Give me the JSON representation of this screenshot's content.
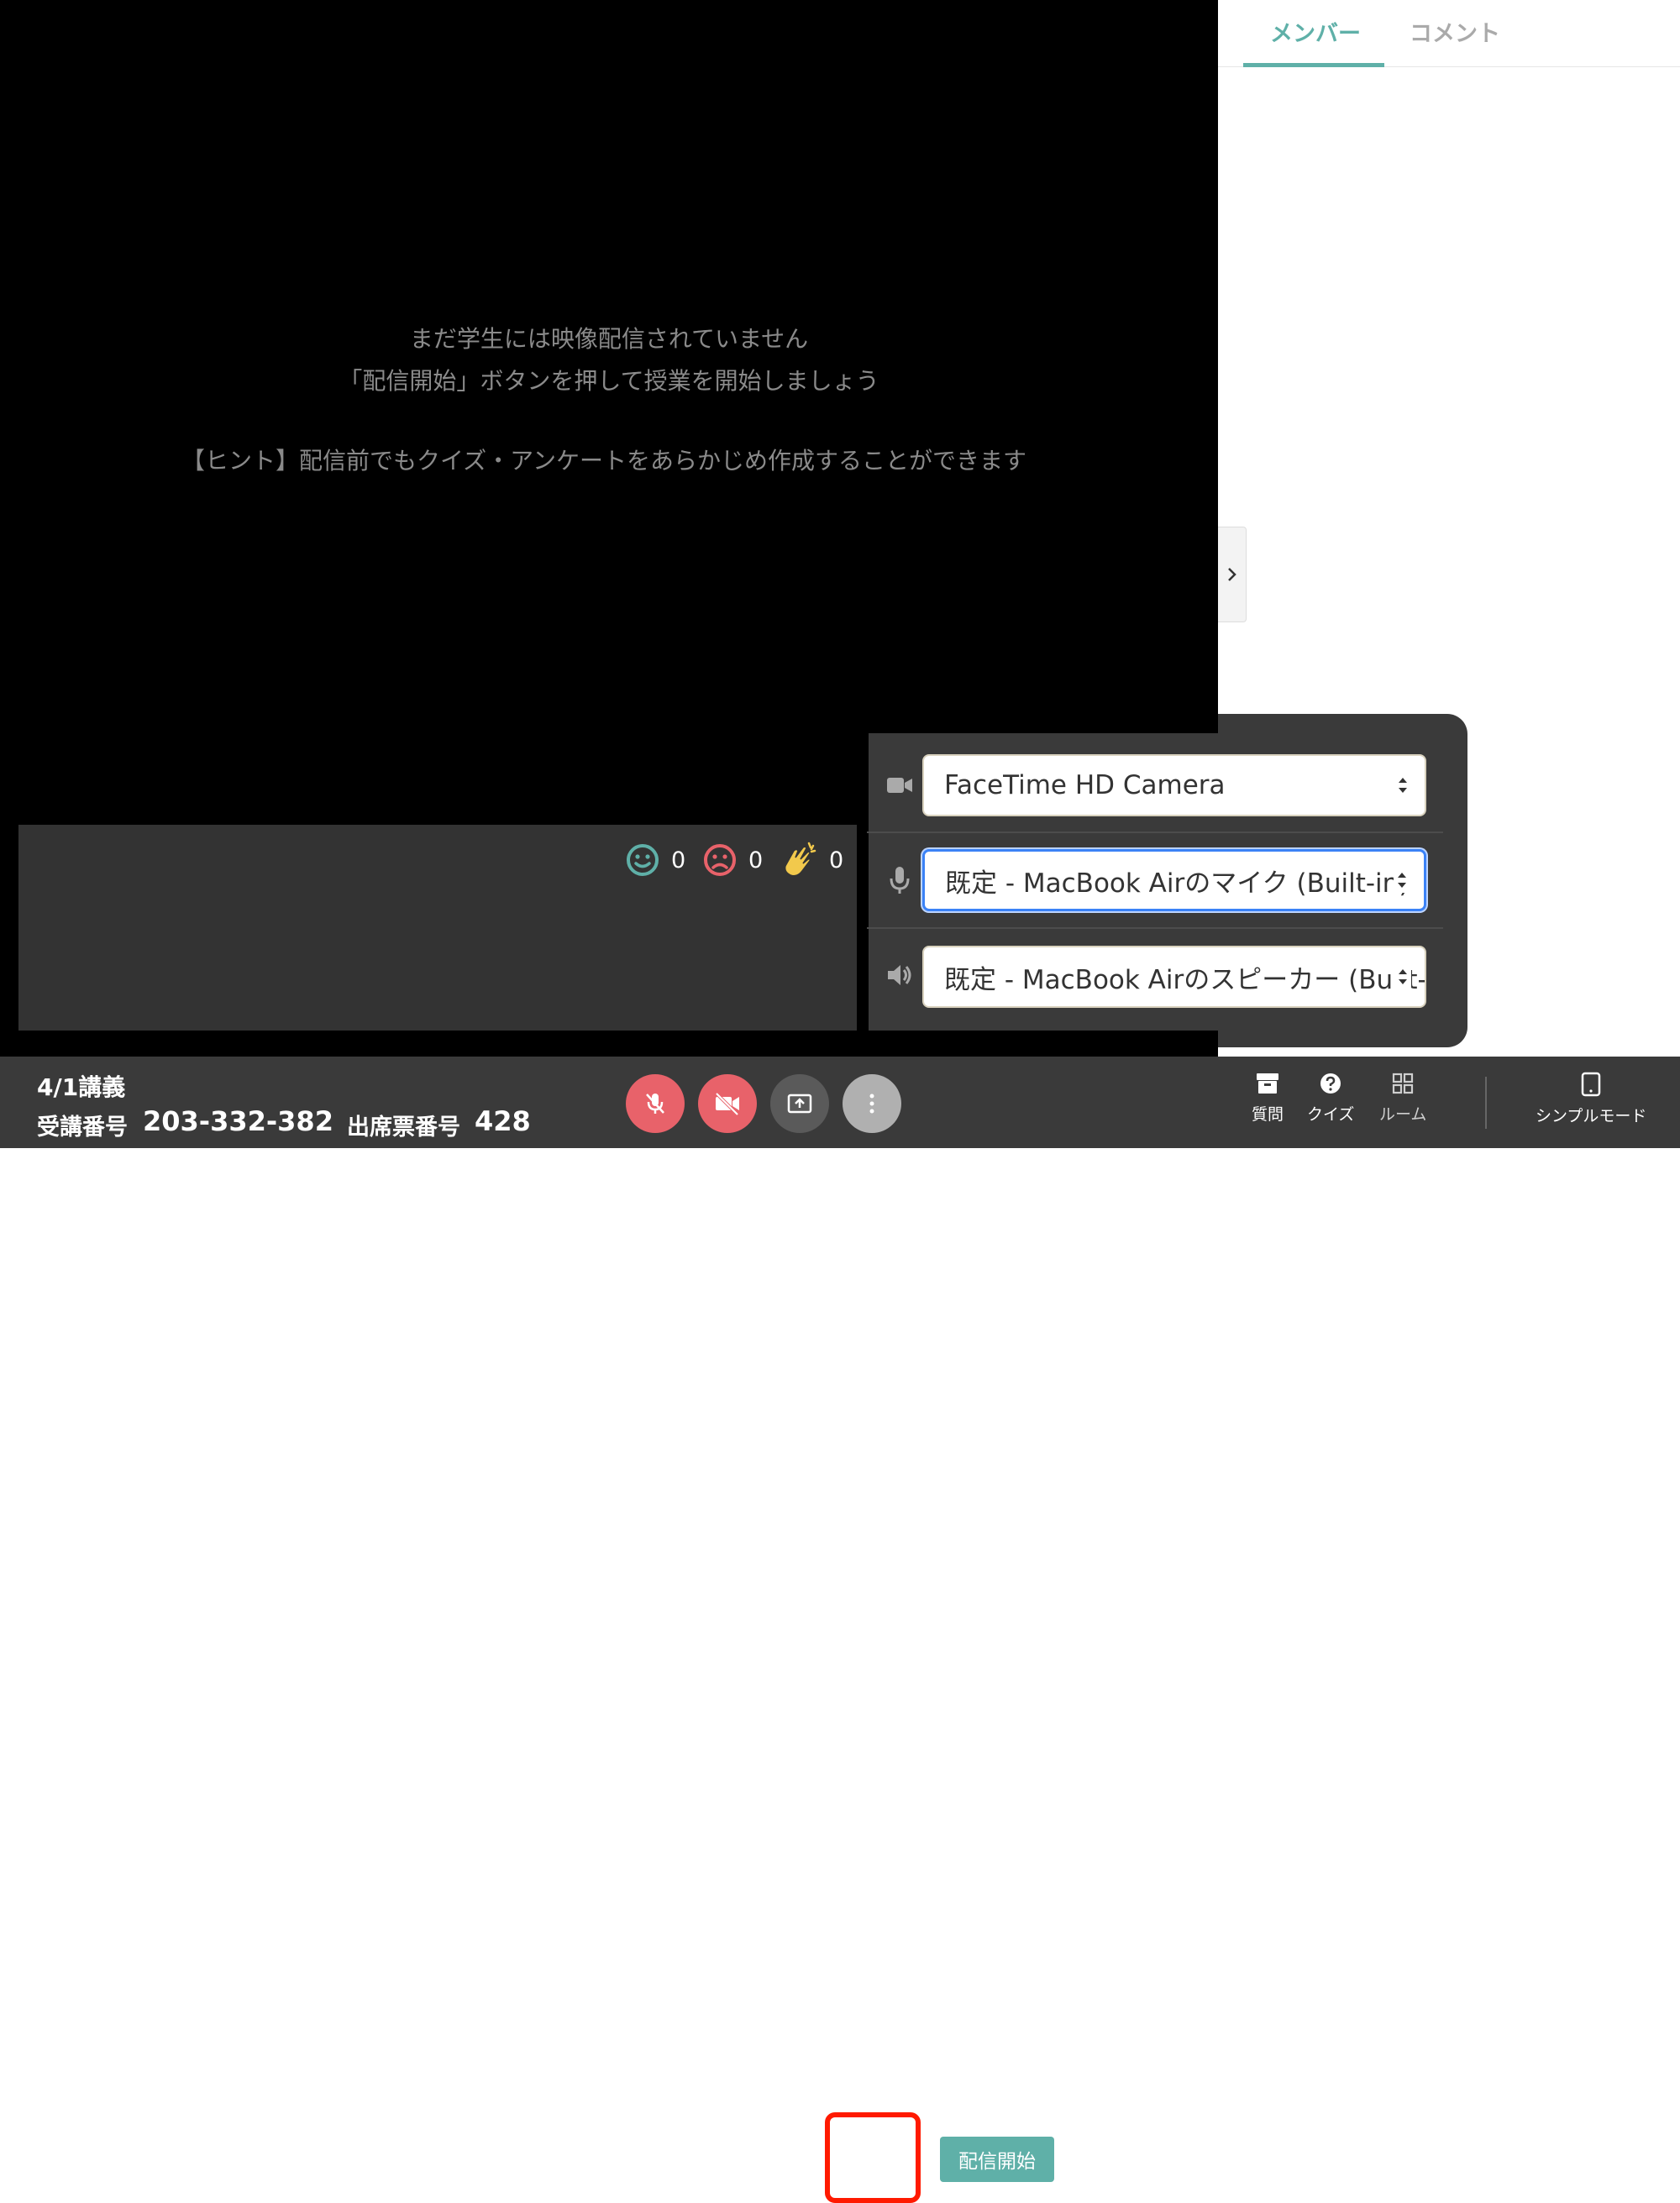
{
  "stage": {
    "message_line1": "まだ学生には映像配信されていません",
    "message_line2": "「配信開始」ボタンを押して授業を開始しましょう",
    "hint": "【ヒント】配信前でもクイズ・アンケートをあらかじめ作成することができます"
  },
  "reactions": [
    {
      "icon": "smile-icon",
      "count": "0",
      "color": "#5fb0a8"
    },
    {
      "icon": "frown-icon",
      "count": "0",
      "color": "#e8626a"
    },
    {
      "icon": "clap-hands-icon",
      "count": "0",
      "color": "#f2c94c"
    }
  ],
  "sidebar": {
    "tabs": [
      {
        "label": "メンバー",
        "active": true
      },
      {
        "label": "コメント",
        "active": false
      }
    ]
  },
  "devices": {
    "camera": "FaceTime HD Camera",
    "microphone": "既定 - MacBook Airのマイク (Built-in)",
    "speaker": "既定 - MacBook Airのスピーカー (Built-in)"
  },
  "toolbar": {
    "lecture": "4/1講義",
    "code_label": "受講番号",
    "code_value": "203-332-382",
    "attendance_label": "出席票番号",
    "attendance_value": "428",
    "start_label": "配信開始",
    "questions_label": "質問",
    "quiz_label": "クイズ",
    "room_label": "ルーム",
    "simple_mode_label": "シンプルモード"
  },
  "colors": {
    "accent": "#5fb0a8",
    "danger": "#e8626a",
    "highlight": "#ff1a00"
  }
}
